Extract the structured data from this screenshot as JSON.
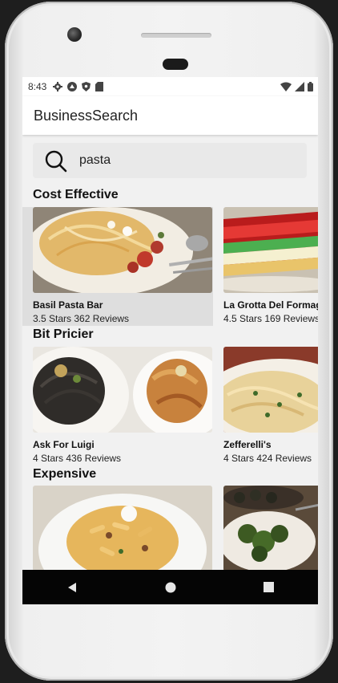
{
  "status_bar": {
    "time": "8:43",
    "left_icons": [
      "gear-icon",
      "android-icon",
      "shield-icon",
      "sd-card-icon"
    ],
    "right_icons": [
      "wifi-icon",
      "signal-icon",
      "battery-icon"
    ]
  },
  "app_bar": {
    "title": "BusinessSearch"
  },
  "search": {
    "query": "pasta"
  },
  "sections": [
    {
      "title": "Cost Effective",
      "items": [
        {
          "name": "Basil Pasta Bar",
          "meta": "3.5 Stars 362 Reviews"
        },
        {
          "name": "La Grotta Del Formag",
          "meta": "4.5 Stars 169 Reviews"
        }
      ]
    },
    {
      "title": "Bit Pricier",
      "items": [
        {
          "name": "Ask For Luigi",
          "meta": "4 Stars 436 Reviews"
        },
        {
          "name": "Zefferelli's",
          "meta": "4 Stars 424 Reviews"
        }
      ]
    },
    {
      "title": "Expensive",
      "items": [
        {
          "name": "",
          "meta": ""
        },
        {
          "name": "",
          "meta": ""
        }
      ]
    }
  ],
  "nav": {
    "buttons": [
      "back-icon",
      "home-icon",
      "recents-icon"
    ]
  },
  "colors": {
    "accent": "#222222",
    "screen_bg": "#f1f1f1",
    "nav_bg": "#050505"
  }
}
